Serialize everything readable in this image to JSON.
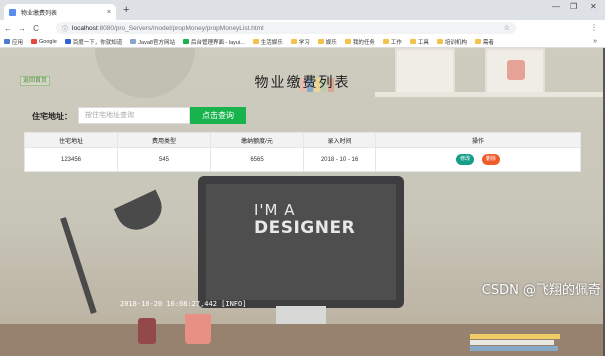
{
  "browser": {
    "tab_title": "物业缴费列表",
    "tab_close": "×",
    "new_tab": "+",
    "win_minimize": "—",
    "win_restore": "❐",
    "win_close": "✕",
    "nav_back": "←",
    "nav_forward": "→",
    "nav_reload": "C",
    "lock_icon_glyph": "ⓘ",
    "url_host": "localhost",
    "url_path": ":8080/pro_Servers/model/propMoney/propMoneyList.html",
    "star_glyph": "☆",
    "menu_glyph": "⋮",
    "bookmarks": [
      {
        "label": "应用",
        "color": "#4a7bd0"
      },
      {
        "label": "Google",
        "color": "#e8453c"
      },
      {
        "label": "百度一下，你就知道",
        "color": "#2f64d6"
      },
      {
        "label": "Java8官方网站",
        "color": "#8aa7c8"
      },
      {
        "label": "后台管理界面 - layui...",
        "color": "#19b34e"
      },
      {
        "label": "生活娱乐",
        "color": "#f3c24b"
      },
      {
        "label": "学习",
        "color": "#f3c24b"
      },
      {
        "label": "娱乐",
        "color": "#f3c24b"
      },
      {
        "label": "我的任务",
        "color": "#f3c24b"
      },
      {
        "label": "工作",
        "color": "#f3c24b"
      },
      {
        "label": "工具",
        "color": "#f3c24b"
      },
      {
        "label": "培训机构",
        "color": "#f3c24b"
      },
      {
        "label": "需者",
        "color": "#f3c24b"
      }
    ],
    "bookmarks_more": "»"
  },
  "page": {
    "back_link": "返回首页",
    "title": "物业缴费列表",
    "search": {
      "label": "住宅地址：",
      "placeholder": "按住宅地址查询",
      "value": "",
      "button": "点击查询"
    },
    "table": {
      "headers": [
        "住宅地址",
        "费用类型",
        "缴纳额度/元",
        "录入时间",
        "操作"
      ],
      "rows": [
        {
          "address": "123456",
          "fee_type": "545",
          "amount": "6565",
          "time": "2018 - 10 - 16",
          "edit": "修改",
          "delete": "删除"
        }
      ]
    },
    "background_text": {
      "line1": "I'M A",
      "line2": "DESIGNER"
    }
  },
  "overlay": {
    "watermark": "CSDN @飞翔的佩奇",
    "console_line": "2018-10-20 16:08:27,442 [INFO]"
  },
  "colors": {
    "primary_green": "#19b34e",
    "edit_teal": "#159c8a",
    "delete_orange": "#f15a29"
  }
}
